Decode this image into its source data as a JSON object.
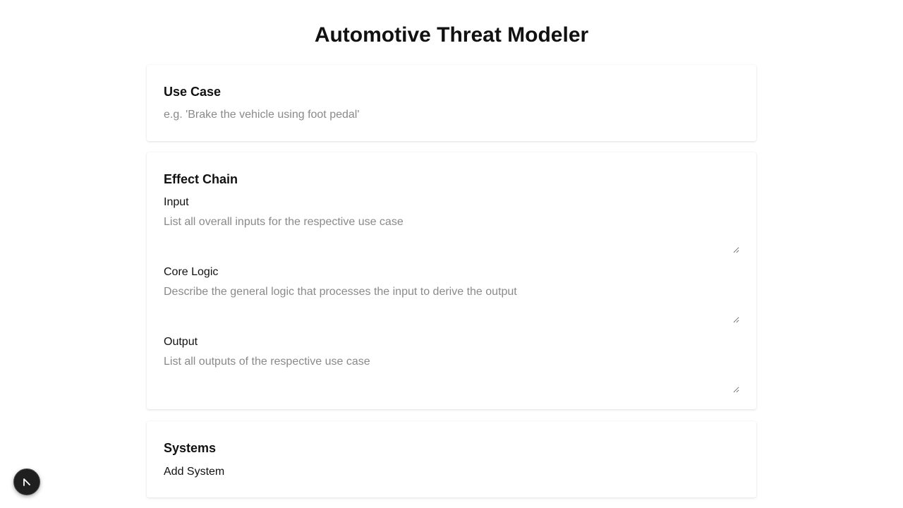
{
  "page": {
    "title": "Automotive Threat Modeler"
  },
  "use_case": {
    "heading": "Use Case",
    "value": "",
    "placeholder": "e.g. 'Brake the vehicle using foot pedal'"
  },
  "effect_chain": {
    "heading": "Effect Chain",
    "input": {
      "label": "Input",
      "value": "",
      "placeholder": "List all overall inputs for the respective use case"
    },
    "core_logic": {
      "label": "Core Logic",
      "value": "",
      "placeholder": "Describe the general logic that processes the input to derive the output"
    },
    "output": {
      "label": "Output",
      "value": "",
      "placeholder": "List all outputs of the respective use case"
    }
  },
  "systems": {
    "heading": "Systems",
    "add_label": "Add System"
  },
  "fab": {
    "icon": "arrow-icon"
  },
  "colors": {
    "background": "#ffffff",
    "text": "#111111",
    "placeholder": "#8a8a8a",
    "fab": "#1f1f1f"
  }
}
